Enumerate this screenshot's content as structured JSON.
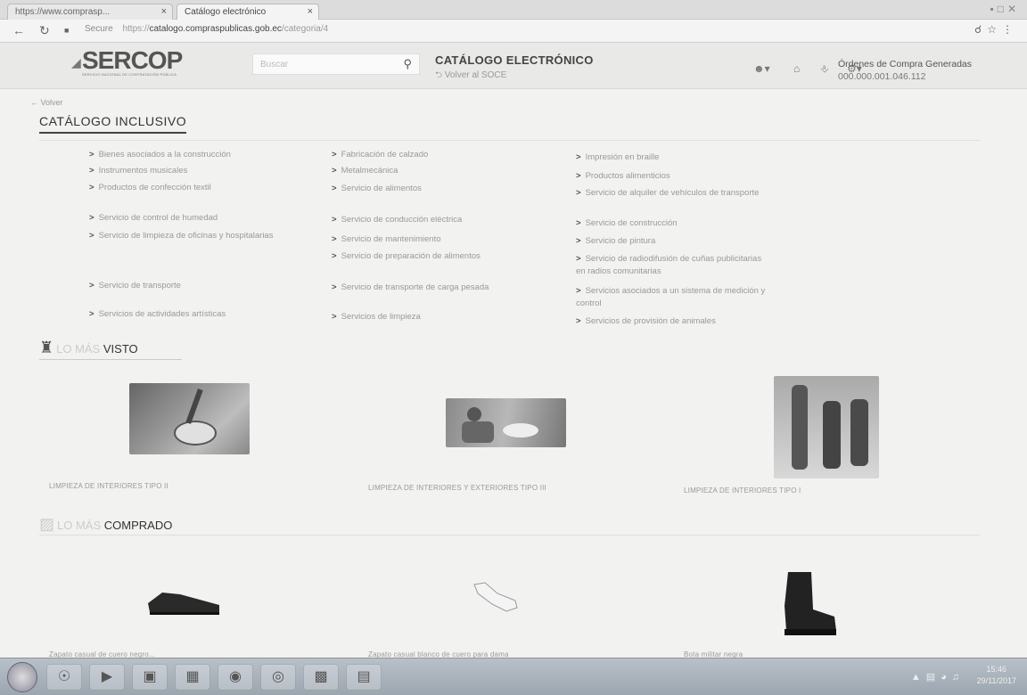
{
  "browser": {
    "tabs": [
      {
        "label": "https://www.comprasp..."
      },
      {
        "label": "Catálogo electrónico"
      }
    ],
    "close_glyph": "×",
    "url_secure": "Secure",
    "url_prefix": "https://",
    "url_host": "catalogo.compraspublicas.gob.ec",
    "url_path": "/categoria/4"
  },
  "header": {
    "logo": "SERCOP",
    "logo_sub": "SERVICIO NACIONAL DE CONTRATACIÓN PÚBLICA",
    "search_placeholder": "Buscar",
    "title": "CATÁLOGO ELECTRÓNICO",
    "back_link": "⮌ Volver al SOCE",
    "orders_label": "Órdenes de Compra Generadas",
    "orders_count": "000.000.001.046.112"
  },
  "page": {
    "back": "← Volver",
    "section_title": "CATÁLOGO INCLUSIVO",
    "categories": [
      "Bienes asociados a la construcción",
      "Fabricación de calzado",
      "Impresión en braille",
      "Instrumentos musicales",
      "Metalmecánica",
      "Productos alimenticios",
      "Productos de confección textil",
      "Servicio de alimentos",
      "Servicio de alquiler de vehículos de transporte",
      "Servicio de control de humedad",
      "Servicio de conducción eléctrica",
      "Servicio de construcción",
      "Servicio de limpieza de oficinas y hospitalarias",
      "Servicio de mantenimiento",
      "Servicio de pintura",
      "Servicio de preparación de alimentos",
      "Servicio de radiodifusión de cuñas publicitarias en radios comunitarias",
      "Servicio de transporte",
      "Servicio de transporte de carga pesada",
      "Servicios asociados a un sistema de medición y control",
      "Servicios de actividades artísticas",
      "Servicios de limpieza",
      "Servicios de provisión de animales"
    ],
    "most_viewed": {
      "faint": "LO MÁS",
      "strong": "VISTO",
      "items": [
        "LIMPIEZA DE INTERIORES TIPO II",
        "LIMPIEZA DE INTERIORES Y EXTERIORES TIPO III",
        "LIMPIEZA DE INTERIORES TIPO I"
      ]
    },
    "most_bought": {
      "faint": "LO MÁS",
      "strong": "COMPRADO",
      "items": [
        "Zapato casual de cuero negro...",
        "Zapato casual blanco de cuero para dama",
        "Bota militar negra"
      ]
    }
  },
  "taskbar": {
    "time": "15:46",
    "date": "29/11/2017"
  }
}
